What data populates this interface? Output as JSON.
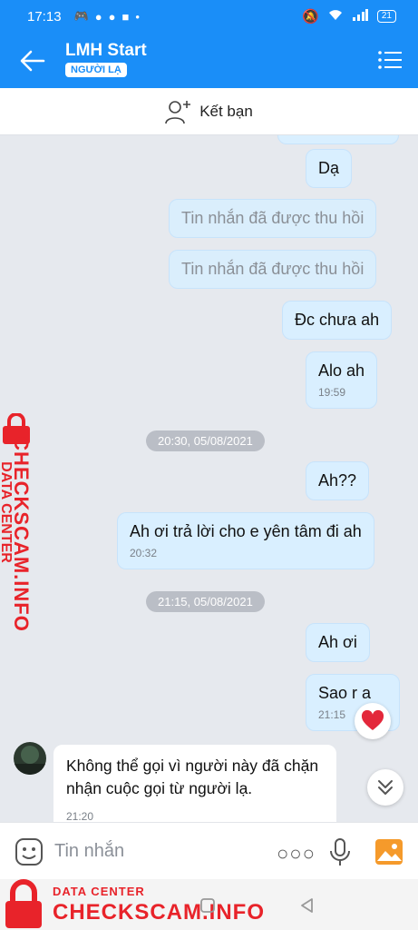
{
  "status_bar": {
    "time": "17:13",
    "battery": "21"
  },
  "header": {
    "title": "LMH Start",
    "badge": "NGƯỜI LẠ"
  },
  "add_friend": {
    "label": "Kết bạn"
  },
  "messages": [
    {
      "text": "Dạ"
    },
    {
      "text": "Tin nhắn đã được thu hồi"
    },
    {
      "text": "Tin nhắn đã được thu hồi"
    },
    {
      "text": "Đc chưa ah"
    },
    {
      "text": "Alo ah",
      "time": "19:59"
    },
    {
      "text": "Ah??"
    },
    {
      "text": "Ah ơi trả lời cho e yên tâm đi ah",
      "time": "20:32"
    },
    {
      "text": "Ah ơi"
    },
    {
      "text": "Sao r a",
      "time": "21:15"
    },
    {
      "text": "Không thể gọi vì người này đã chặn nhận cuộc gọi từ người lạ.",
      "time": "21:20"
    }
  ],
  "separators": [
    "20:30, 05/08/2021",
    "21:15, 05/08/2021"
  ],
  "input": {
    "placeholder": "Tin nhắn"
  },
  "watermark": {
    "small": "DATA CENTER",
    "big": "CHECKSCAM.INFO"
  },
  "colors": {
    "primary": "#1a8ef8",
    "bubble_out": "#d9efff",
    "watermark": "#e8232a"
  }
}
